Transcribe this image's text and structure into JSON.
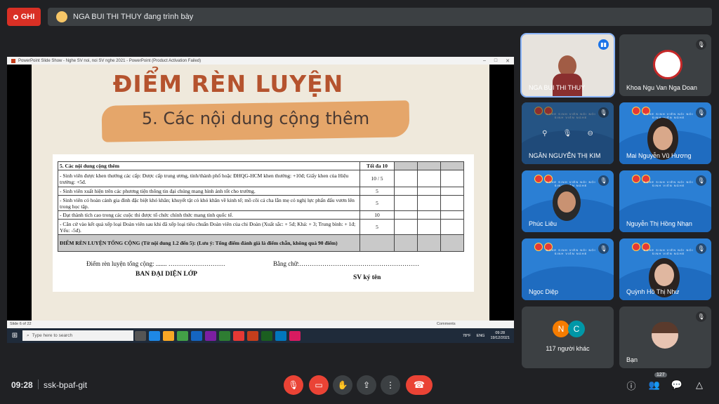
{
  "top": {
    "record_label": "GHI",
    "presenter_text": "NGA BUI THI THUY đang trình bày"
  },
  "share": {
    "window_title": "PowerPoint Slide Show - Nghe SV noi, noi SV nghe 2021 - PowerPoint (Product Activation Failed)",
    "slide_title": "ĐIỂM RÈN LUYỆN",
    "slide_subtitle": "5. Các nội dung cộng thêm",
    "table": {
      "header": [
        "5. Các nội dung cộng thêm",
        "Tối đa 10"
      ],
      "rows": [
        {
          "text": "- Sinh viên được khen thưởng các cấp: Được cấp trung ương, tỉnh/thành phố hoặc ĐHQG-HCM khen thưởng: +10đ; Giấy khen của Hiệu trưởng: +5đ.",
          "max": "10 / 5"
        },
        {
          "text": "- Sinh viên xuất hiện trên các phương tiện thông tin đại chúng mang hình ảnh tốt cho trường.",
          "max": "5"
        },
        {
          "text": "- Sinh viên có hoàn cảnh gia đình đặc biệt khó khăn; khuyết tật có khó khăn về kinh tế; mồ côi cả cha lẫn mẹ có nghị lực phấn đấu vươn lên trong học tập.",
          "max": "5"
        },
        {
          "text": "- Đạt thành tích cao trong các cuộc thi được tổ chức chính thức mang tính quốc tế.",
          "max": "10"
        },
        {
          "text": "- Căn cứ vào kết quả xếp loại Đoàn viên sau khi đã xếp loại tiêu chuẩn Đoàn viên của chi Đoàn (Xuất sắc: + 5đ; Khá: + 3; Trung bình: + 1đ; Yếu: -5đ).",
          "max": "5"
        }
      ],
      "total": "ĐIỂM RÈN LUYỆN TỔNG CỘNG (Từ nội dung 1.2 đến 5): (Lưu ý: Tổng điểm đánh giá là điểm chẵn, không quá 90 điểm)"
    },
    "total_line": "Điểm rèn luyện tổng cộng: ....... ………………………",
    "words_line": "Bằng chữ:…………………………………………………",
    "class_rep": "BAN ĐẠI DIỆN LỚP",
    "student_sign": "SV ký tên",
    "slide_counter": "Slide 6 of 22",
    "comments": "Comments",
    "taskbar_search": "Type here to search",
    "weather": "78°F",
    "lang": "ENG",
    "time": "09:28",
    "date": "19/12/2021"
  },
  "tiles": [
    {
      "name": "NGA BUI THI THUY"
    },
    {
      "name": "Khoa Ngu Van Nga Doan"
    },
    {
      "name": "NGÂN NGUYỄN THỊ KIM"
    },
    {
      "name": "Mai Nguyễn Vũ Hương"
    },
    {
      "name": "Phúc Liêu"
    },
    {
      "name": "Nguyễn Thị Hồng Nhạn"
    },
    {
      "name": "Ngọc Diệp"
    },
    {
      "name": "Quỳnh Hồ Thị Như"
    },
    {
      "name": "117 người khác",
      "avatars": [
        "N",
        "C"
      ]
    },
    {
      "name": "Bạn"
    }
  ],
  "banner_text": "NGHE SINH VIÊN NÓI NÓI SINH VIÊN NGHE",
  "bottom": {
    "clock": "09:28",
    "meeting_code": "ssk-bpaf-git",
    "participant_count": "127"
  },
  "colors": {
    "accent": "#8ab4f8",
    "danger": "#ea4335",
    "bg": "#202124"
  }
}
